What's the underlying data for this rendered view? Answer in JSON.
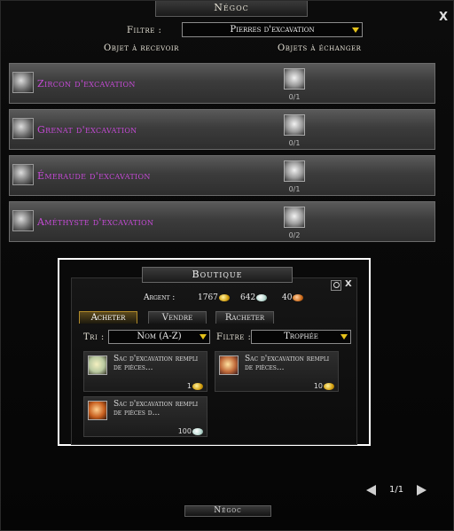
{
  "window": {
    "title": "Négoc",
    "close": "X"
  },
  "filter": {
    "label": "Filtre :",
    "value": "Pierres d'excavation"
  },
  "columns": {
    "receive": "Objet à recevoir",
    "exchange": "Objets à échanger"
  },
  "rows": [
    {
      "name": "Zircon d'excavation",
      "qty": "0/1"
    },
    {
      "name": "Grenat d'excavation",
      "qty": "0/1"
    },
    {
      "name": "Émeraude d'excavation",
      "qty": "0/1"
    },
    {
      "name": "Améthyste d'excavation",
      "qty": "0/2"
    }
  ],
  "shop": {
    "title": "Boutique",
    "money_label": "Argent :",
    "gold": "1767",
    "silver": "642",
    "copper": "40",
    "tabs": [
      "Acheter",
      "Vendre",
      "Racheter"
    ],
    "sort_label": "Tri :",
    "sort_value": "Nom (A-Z)",
    "filter_label": "Filtre :",
    "filter_value": "Trophée",
    "items": [
      {
        "name": "Sac d'excavation rempli de pièces...",
        "price": "1"
      },
      {
        "name": "Sac d'excavation rempli de pièces...",
        "price": "10"
      },
      {
        "name": "Sac d'excavation rempli de pièces d...",
        "price": "100"
      }
    ]
  },
  "pager": {
    "text": "1/1"
  },
  "bottom_tab": "Négoc",
  "colors": {
    "item_name": "#c54ad6",
    "accent": "#e5c21a"
  }
}
